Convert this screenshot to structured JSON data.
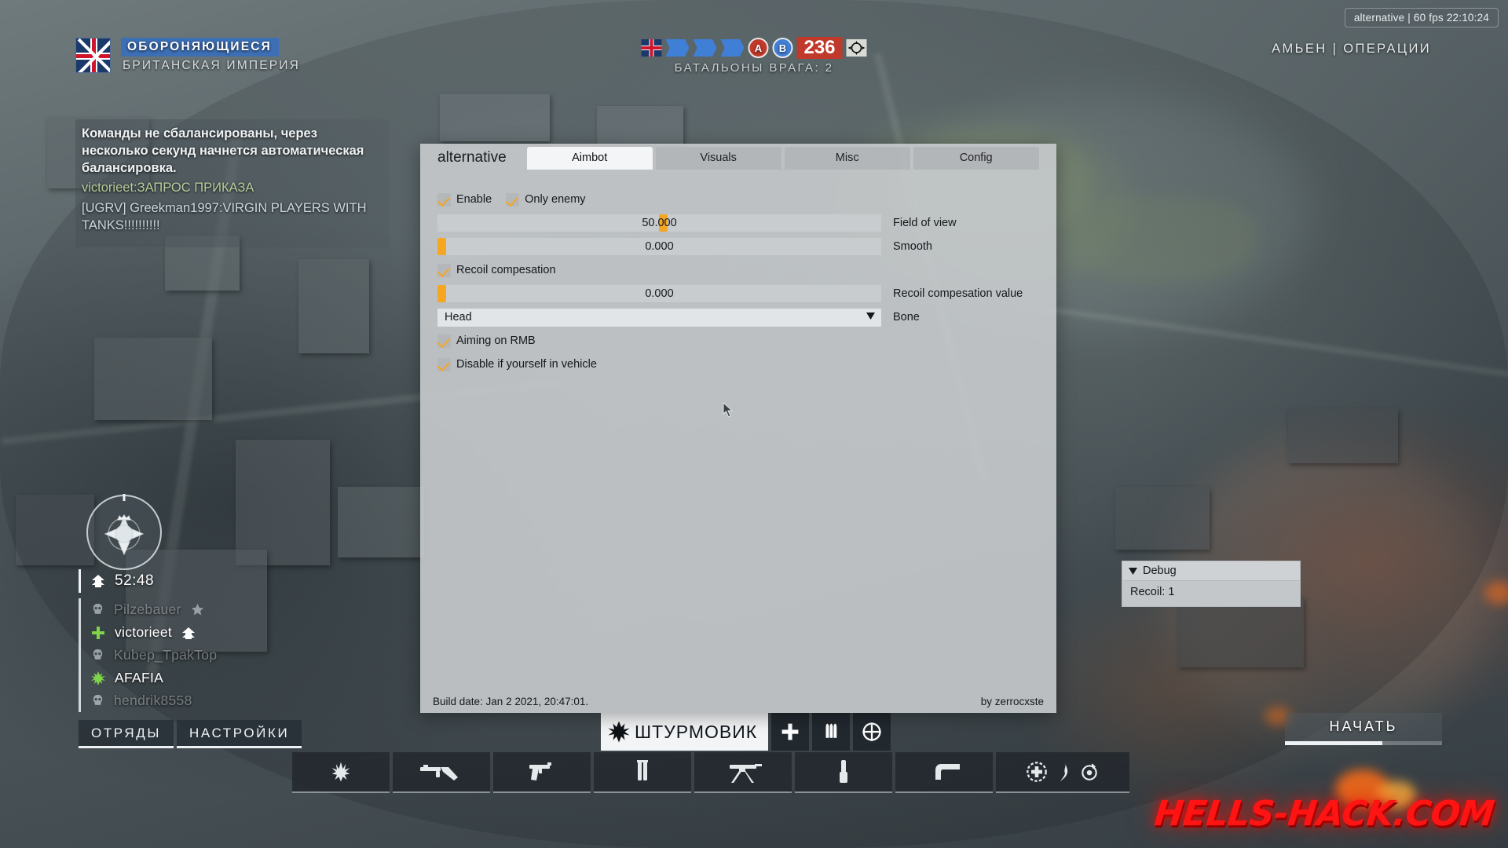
{
  "hud": {
    "team": {
      "status": "ОБОРОНЯЮЩИЕСЯ",
      "faction": "БРИТАНСКАЯ ИМПЕРИЯ",
      "flag_icon": "union-jack-flag-icon"
    },
    "score": {
      "objective_a": "A",
      "objective_b": "B",
      "points": "236",
      "battalions": "БАТАЛЬОНЫ ВРАГА: 2"
    },
    "map_mode": "АМЬЕН | ОПЕРАЦИИ",
    "overlay_status": "alternative |   60 fps 22:10:24",
    "chat": [
      {
        "type": "system",
        "text": "Команды не сбалансированы, через несколько секунд начнется автоматическая балансировка."
      },
      {
        "type": "player",
        "text": "victorieet:ЗАПРОС ПРИКАЗА"
      },
      {
        "type": "player2",
        "text": "[UGRV] Greekman1997:VIRGIN PLAYERS WITH TANKS!!!!!!!!!!"
      }
    ],
    "compass_icon": "compass-rose-icon",
    "squad": {
      "timer": "52:48",
      "timer_icon": "spawn-arrow-icon",
      "members": [
        {
          "name": "Pilzebauer",
          "state": "dead",
          "icon": "skull-icon",
          "badge": "star-icon"
        },
        {
          "name": "victorieet",
          "state": "alive",
          "icon": "medic-cross-icon",
          "badge": "spawn-arrow-icon"
        },
        {
          "name": "Kubep_TpakTop",
          "state": "dead",
          "icon": "skull-icon",
          "badge": ""
        },
        {
          "name": "AFAFIA",
          "state": "alive",
          "icon": "assault-burst-icon",
          "badge": ""
        },
        {
          "name": "hendrik8558",
          "state": "dead",
          "icon": "skull-icon",
          "badge": ""
        }
      ]
    },
    "bottom_buttons": [
      {
        "label": "ОТРЯДЫ",
        "name": "squads-button"
      },
      {
        "label": "НАСТРОЙКИ",
        "name": "settings-button"
      }
    ],
    "kit": {
      "label": "ШТУРМОВИК",
      "class_icon": "assault-burst-icon",
      "squares": [
        "medic-cross-icon",
        "ammo-icon",
        "scout-target-icon"
      ]
    },
    "deploy": {
      "label": "НАЧАТЬ",
      "progress": 62
    },
    "weapon_slots": [
      "grenade-icon",
      "smg-icon",
      "pistol-icon",
      "syringe-icon",
      "mg-tripod-icon",
      "grenade-stick-icon",
      "melee-club-icon",
      "gadget-group-icon"
    ],
    "watermark": "HELLS-HACK.COM"
  },
  "debug": {
    "title": "Debug",
    "caret_icon": "triangle-down-icon",
    "lines": [
      "Recoil: 1"
    ]
  },
  "menu": {
    "app_name": "alternative",
    "tabs": [
      {
        "label": "Aimbot",
        "active": true
      },
      {
        "label": "Visuals",
        "active": false
      },
      {
        "label": "Misc",
        "active": false
      },
      {
        "label": "Config",
        "active": false
      }
    ],
    "aimbot": {
      "enable": {
        "label": "Enable",
        "checked": true
      },
      "only_enemy": {
        "label": "Only enemy",
        "checked": true
      },
      "field_of_view": {
        "label": "Field of view",
        "value": "50.000",
        "percent": 40
      },
      "smooth": {
        "label": "Smooth",
        "value": "0.000",
        "percent": 0
      },
      "recoil_compensation": {
        "label": "Recoil compesation",
        "checked": true
      },
      "recoil_compensation_value": {
        "label": "Recoil compesation value",
        "value": "0.000",
        "percent": 0
      },
      "bone": {
        "label": "Bone",
        "value": "Head",
        "caret_icon": "triangle-down-icon"
      },
      "aiming_on_rmb": {
        "label": "Aiming on RMB",
        "checked": true
      },
      "disable_in_vehicle": {
        "label": "Disable if yourself in vehicle",
        "checked": true
      }
    },
    "footer": {
      "build": "Build date: Jan  2 2021, 20:47:01.",
      "author": "by zerrocxste"
    }
  }
}
